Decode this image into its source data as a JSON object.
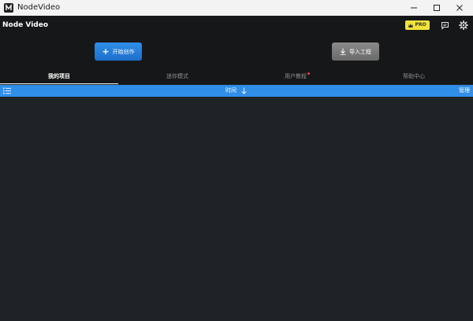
{
  "window": {
    "title": "NodeVideo",
    "controls": {
      "minimize": "minimize-icon",
      "maximize": "maximize-icon",
      "close": "close-icon"
    }
  },
  "header": {
    "app_name": "Node Video",
    "pro_label": "PRO",
    "icons": [
      "crown-icon",
      "feedback-icon",
      "gear-icon"
    ]
  },
  "actions": {
    "create_label": "开始创作",
    "import_label": "导入工程",
    "create_color": "#2f8fe8",
    "import_color": "#7a7a7a"
  },
  "tabs": [
    {
      "label": "我的项目",
      "active": true
    },
    {
      "label": "迷你模式",
      "active": false
    },
    {
      "label": "用户教程",
      "active": false,
      "badge": "red-dot"
    },
    {
      "label": "帮助中心",
      "active": false
    }
  ],
  "listbar": {
    "sort_label": "时间",
    "manage_label": "管理",
    "accent": "#2f8ee8"
  },
  "colors": {
    "background": "#1e2326",
    "header": "#161718",
    "pro_badge": "#f2e33b"
  }
}
